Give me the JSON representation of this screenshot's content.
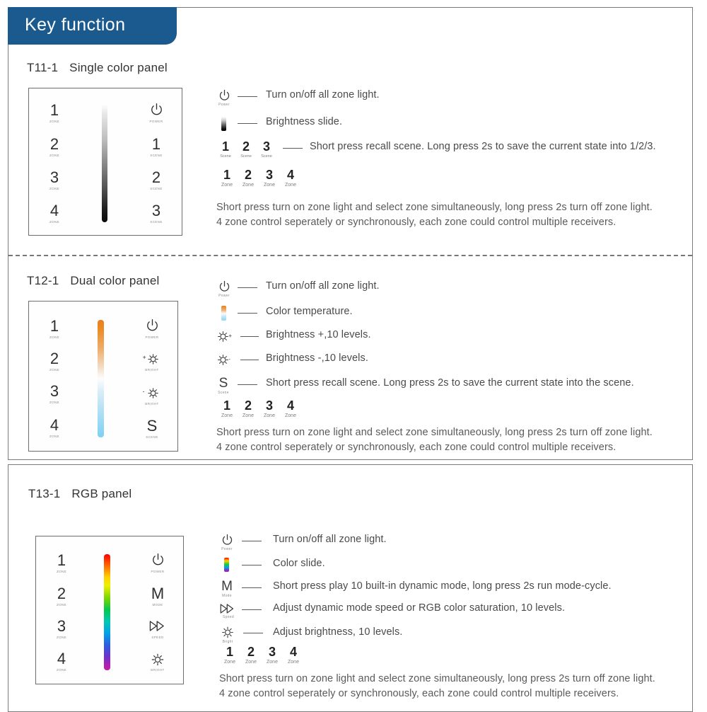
{
  "header": {
    "title": "Key function",
    "accent_color": "#1a5a8e"
  },
  "sections": [
    {
      "id": "t11",
      "code": "T11-1",
      "name": "Single color panel",
      "panel": {
        "zones": [
          {
            "number": "1",
            "caption": "ZONE"
          },
          {
            "number": "2",
            "caption": "ZONE"
          },
          {
            "number": "3",
            "caption": "ZONE"
          },
          {
            "number": "4",
            "caption": "ZONE"
          }
        ],
        "slider": {
          "type": "brightness-gradient",
          "name": "brightness-slider"
        },
        "right_keys": [
          {
            "glyph": "power-icon",
            "label": "",
            "caption": "POWER"
          },
          {
            "glyph": "text",
            "label": "1",
            "caption": "SCENE"
          },
          {
            "glyph": "text",
            "label": "2",
            "caption": "SCENE"
          },
          {
            "glyph": "text",
            "label": "3",
            "caption": "SCENE"
          }
        ]
      },
      "legend": [
        {
          "icon": "power-icon",
          "caption": "Power",
          "text": "Turn on/off all zone light."
        },
        {
          "icon": "brightness-slide-icon",
          "caption": "",
          "text": "Brightness slide."
        },
        {
          "icon": "scene-123-icon",
          "caption": "Scene",
          "text": "Short press recall scene. Long press 2s to save the current state into 1/2/3."
        }
      ],
      "zone_row": [
        {
          "number": "1",
          "caption": "Zone"
        },
        {
          "number": "2",
          "caption": "Zone"
        },
        {
          "number": "3",
          "caption": "Zone"
        },
        {
          "number": "4",
          "caption": "Zone"
        }
      ],
      "paragraph_line1": "Short press turn on zone light and select zone simultaneously, long press 2s turn off zone light.",
      "paragraph_line2": "4 zone control seperately or synchronously, each zone could control multiple receivers."
    },
    {
      "id": "t12",
      "code": "T12-1",
      "name": "Dual color panel",
      "panel": {
        "zones": [
          {
            "number": "1",
            "caption": "ZONE"
          },
          {
            "number": "2",
            "caption": "ZONE"
          },
          {
            "number": "3",
            "caption": "ZONE"
          },
          {
            "number": "4",
            "caption": "ZONE"
          }
        ],
        "slider": {
          "type": "color-temperature-gradient",
          "name": "cct-slider"
        },
        "right_keys": [
          {
            "glyph": "power-icon",
            "label": "",
            "caption": "POWER"
          },
          {
            "glyph": "brightness-up-icon",
            "label": "+",
            "caption": "BRIGHT"
          },
          {
            "glyph": "brightness-down-icon",
            "label": "-",
            "caption": "BRIGHT"
          },
          {
            "glyph": "text",
            "label": "S",
            "caption": "SCENE"
          }
        ]
      },
      "legend": [
        {
          "icon": "power-icon",
          "caption": "Power",
          "text": "Turn on/off all zone light."
        },
        {
          "icon": "color-temperature-icon",
          "caption": "",
          "text": "Color temperature."
        },
        {
          "icon": "brightness-up-icon",
          "caption": "",
          "text": "Brightness +,10 levels."
        },
        {
          "icon": "brightness-down-icon",
          "caption": "",
          "text": "Brightness -,10 levels."
        },
        {
          "icon": "scene-s-icon",
          "caption": "Scene",
          "text": "Short press recall scene. Long press 2s to save the current state into the scene."
        }
      ],
      "zone_row": [
        {
          "number": "1",
          "caption": "Zone"
        },
        {
          "number": "2",
          "caption": "Zone"
        },
        {
          "number": "3",
          "caption": "Zone"
        },
        {
          "number": "4",
          "caption": "Zone"
        }
      ],
      "paragraph_line1": "Short press turn on zone light and select zone simultaneously, long press 2s turn off zone light.",
      "paragraph_line2": "4 zone control seperately or synchronously, each zone could control multiple receivers."
    },
    {
      "id": "t13",
      "code": "T13-1",
      "name": "RGB panel",
      "panel": {
        "zones": [
          {
            "number": "1",
            "caption": "ZONE"
          },
          {
            "number": "2",
            "caption": "ZONE"
          },
          {
            "number": "3",
            "caption": "ZONE"
          },
          {
            "number": "4",
            "caption": "ZONE"
          }
        ],
        "slider": {
          "type": "rgb-rainbow-gradient",
          "name": "color-slider"
        },
        "right_keys": [
          {
            "glyph": "power-icon",
            "label": "",
            "caption": "POWER"
          },
          {
            "glyph": "text",
            "label": "M",
            "caption": "MODE"
          },
          {
            "glyph": "speed-icon",
            "label": "",
            "caption": "SPEED"
          },
          {
            "glyph": "brightness-icon",
            "label": "",
            "caption": "BRIGHT"
          }
        ]
      },
      "legend": [
        {
          "icon": "power-icon",
          "caption": "Power",
          "text": "Turn on/off all zone light."
        },
        {
          "icon": "color-slide-icon",
          "caption": "",
          "text": "Color slide."
        },
        {
          "icon": "mode-icon",
          "caption": "Mode",
          "text": "Short press play 10 built-in dynamic mode, long press 2s run mode-cycle."
        },
        {
          "icon": "speed-icon",
          "caption": "Speed",
          "text": "Adjust dynamic mode speed or RGB color saturation, 10 levels."
        },
        {
          "icon": "brightness-icon",
          "caption": "Bright",
          "text": "Adjust brightness, 10 levels."
        }
      ],
      "zone_row": [
        {
          "number": "1",
          "caption": "Zone"
        },
        {
          "number": "2",
          "caption": "Zone"
        },
        {
          "number": "3",
          "caption": "Zone"
        },
        {
          "number": "4",
          "caption": "Zone"
        }
      ],
      "paragraph_line1": "Short press turn on zone light and select zone simultaneously, long press 2s turn off zone light.",
      "paragraph_line2": "4 zone control seperately or synchronously, each zone could control multiple receivers."
    }
  ]
}
